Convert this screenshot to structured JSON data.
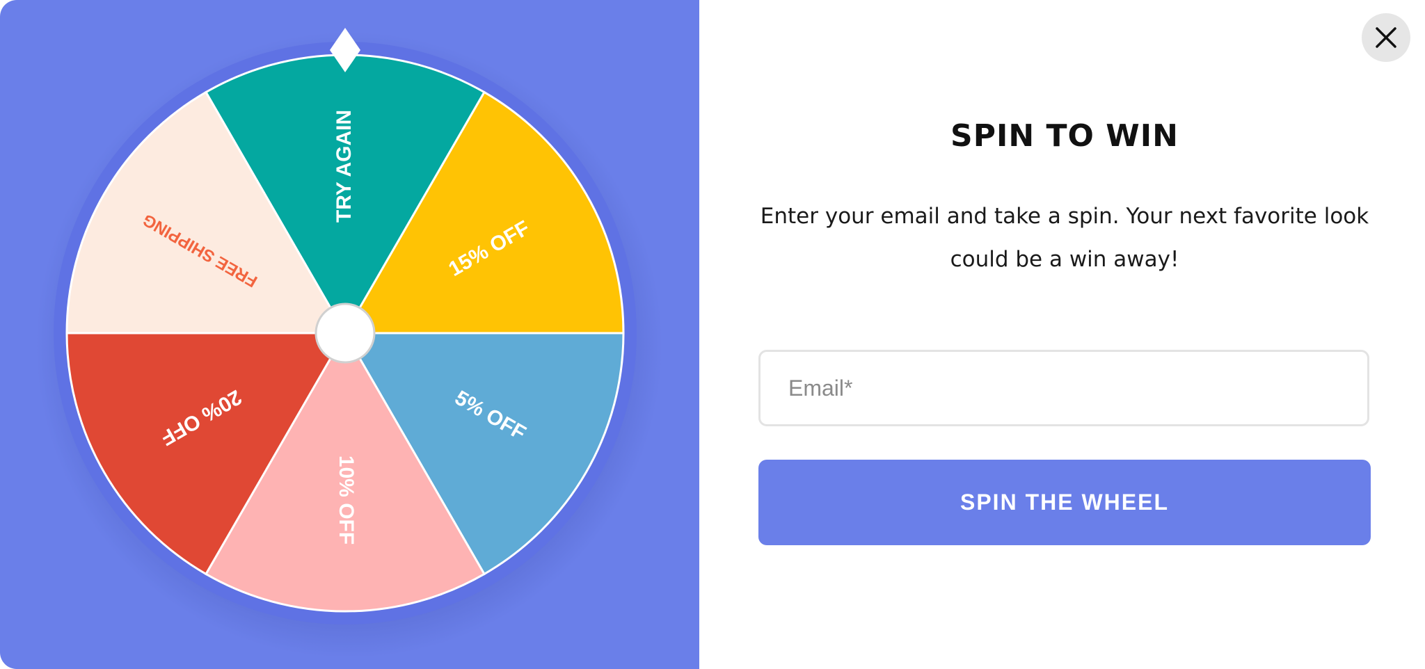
{
  "popup": {
    "title": "SPIN TO WIN",
    "subtitle_line1": "Enter your email and take a spin. Your next favorite look",
    "subtitle_line2": "could be a win away!",
    "email_placeholder": "Email*",
    "spin_button_label": "SPIN THE WHEEL",
    "close_icon": "close-icon",
    "accent_color": "#6a7fe9"
  },
  "wheel": {
    "segments": [
      {
        "label": "TRY AGAIN",
        "color": "#04a8a0",
        "text_color": "#ffffff"
      },
      {
        "label": "15% OFF",
        "color": "#ffc304",
        "text_color": "#ffffff"
      },
      {
        "label": "5% OFF",
        "color": "#5fabd6",
        "text_color": "#ffffff"
      },
      {
        "label": "10% OFF",
        "color": "#feb3b3",
        "text_color": "#ffffff"
      },
      {
        "label": "20% OFF",
        "color": "#e04834",
        "text_color": "#ffffff"
      },
      {
        "label": "FREE SHIPPING",
        "color": "#fdebe0",
        "text_color": "#f2643f"
      }
    ],
    "rim_color": "#5f72e4",
    "pointer_icon": "diamond-pointer-icon"
  }
}
